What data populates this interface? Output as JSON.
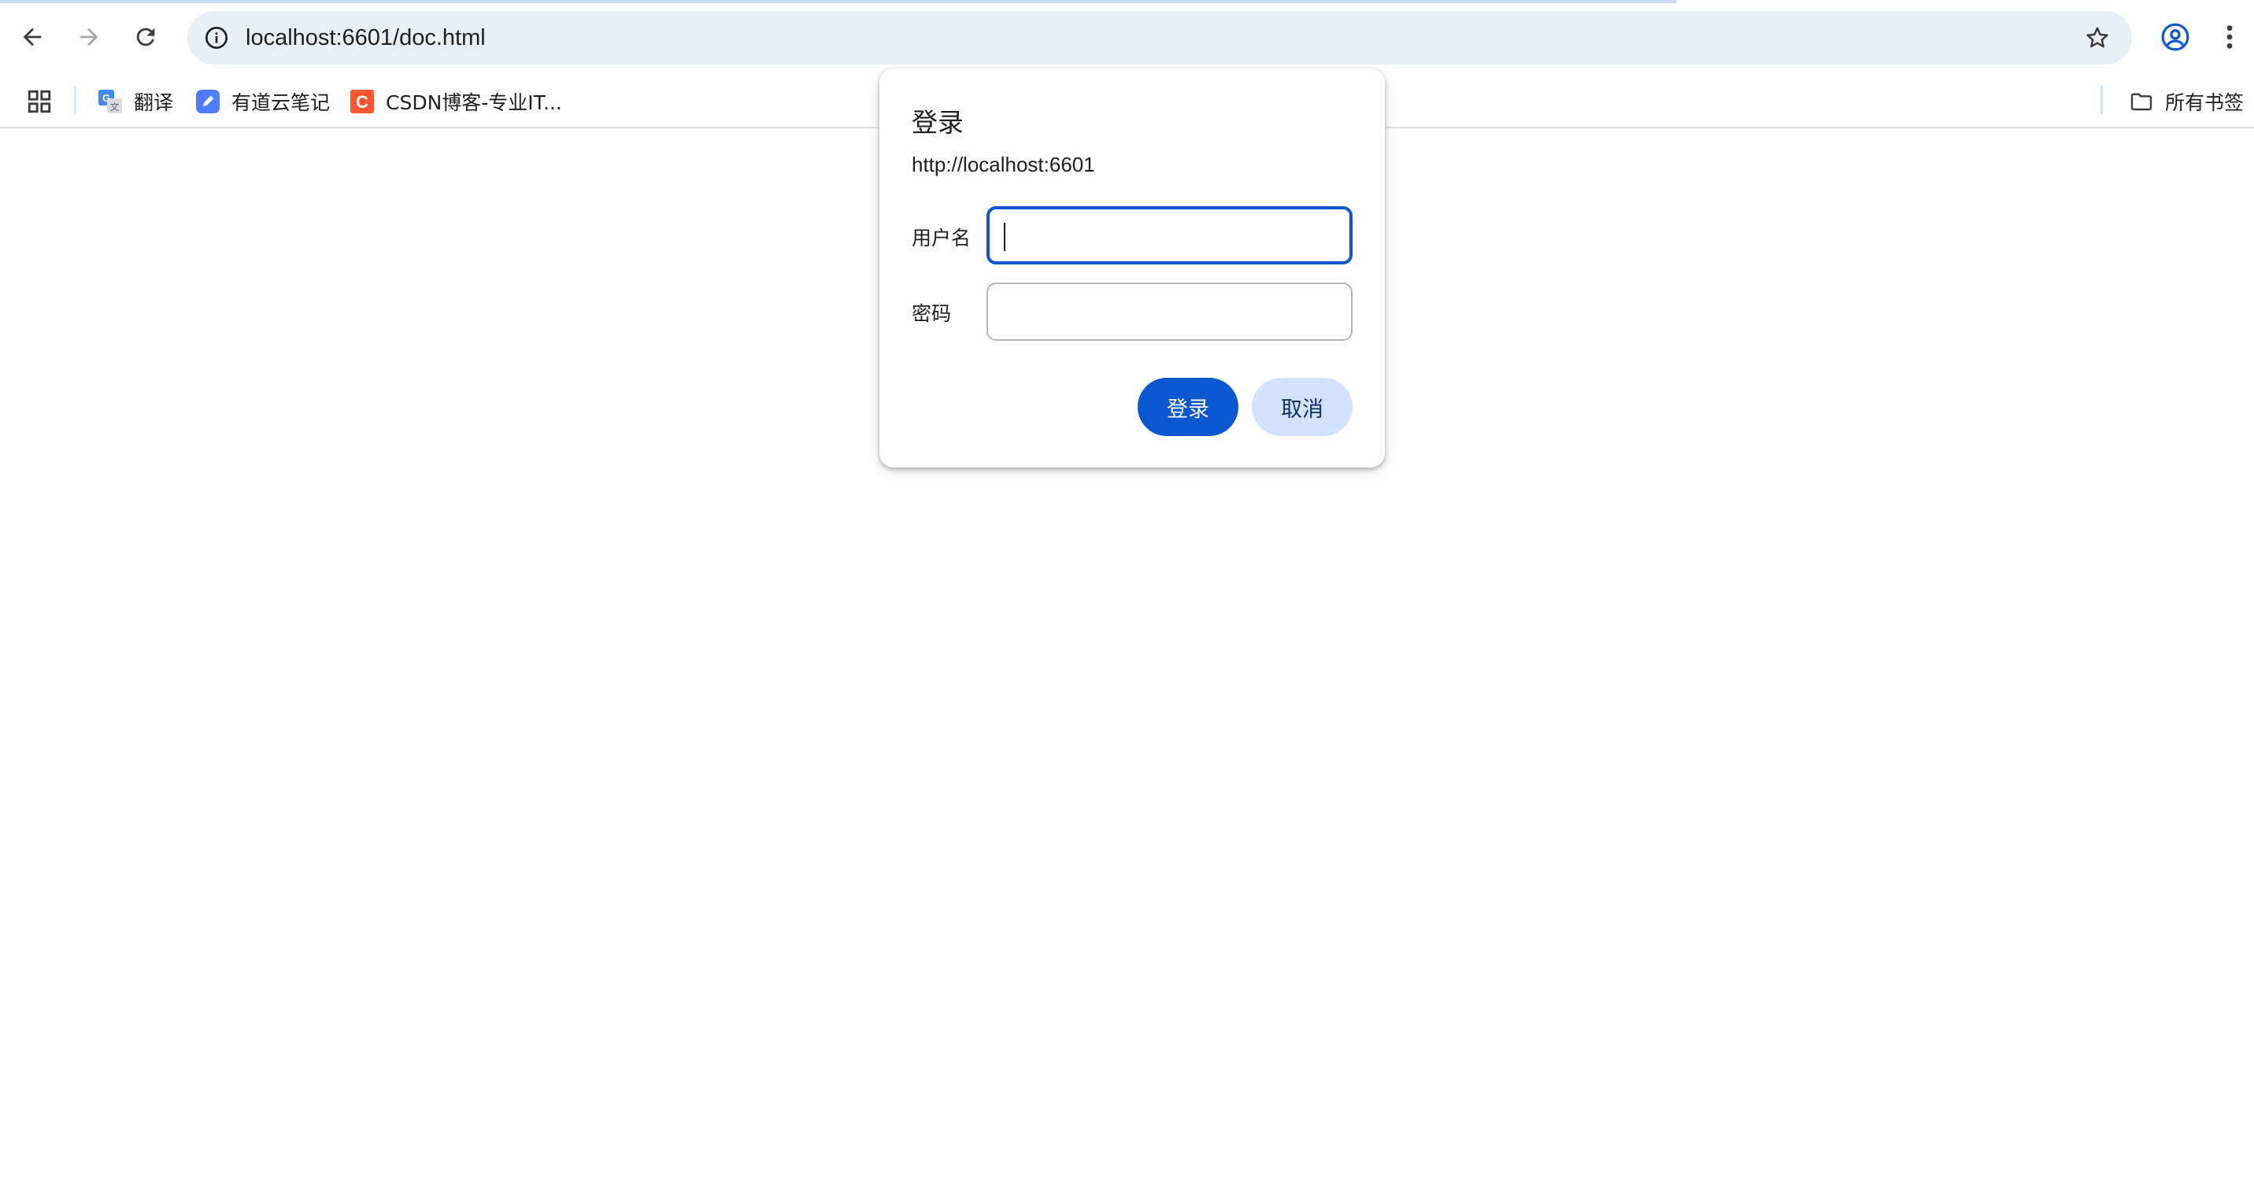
{
  "browser": {
    "url": "localhost:6601/doc.html",
    "colors": {
      "toolbar_bg": "#ffffff",
      "omnibox_bg": "#eaeef5",
      "accent": "#0b57d0",
      "secondary_button": "#d3e3fd"
    }
  },
  "bookmarks": {
    "items": [
      {
        "label": "翻译",
        "icon": "google-translate-icon"
      },
      {
        "label": "有道云笔记",
        "icon": "youdao-note-icon"
      },
      {
        "label": "CSDN博客-专业IT...",
        "icon": "csdn-icon"
      }
    ],
    "all_bookmarks_label": "所有书签"
  },
  "dialog": {
    "title": "登录",
    "origin": "http://localhost:6601",
    "username_label": "用户名",
    "username_value": "",
    "password_label": "密码",
    "password_value": "",
    "login_button": "登录",
    "cancel_button": "取消"
  }
}
